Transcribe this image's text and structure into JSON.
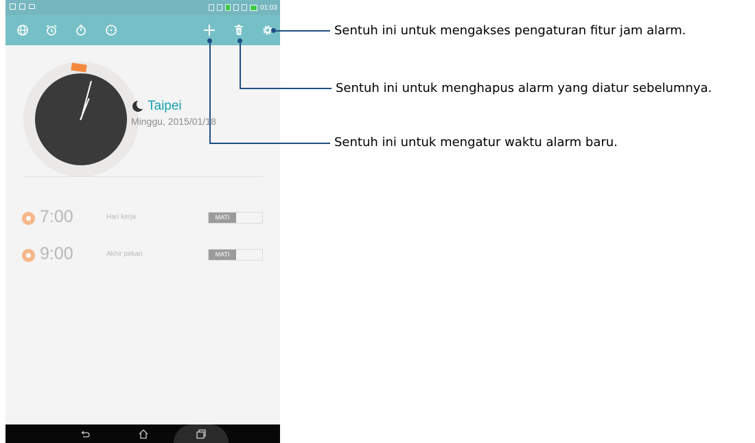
{
  "status_bar": {
    "time": "01:03"
  },
  "toolbar": {
    "tabs": [
      {
        "icon": "globe-icon"
      },
      {
        "icon": "alarm-clock-icon"
      },
      {
        "icon": "stopwatch-icon"
      },
      {
        "icon": "timer-icon"
      }
    ],
    "actions": [
      {
        "icon": "plus-icon"
      },
      {
        "icon": "trash-icon"
      },
      {
        "icon": "gear-icon"
      }
    ]
  },
  "clock": {
    "city": "Taipei",
    "date": "Minggu, 2015/01/18",
    "accent_color": "#14a3b0"
  },
  "alarms": [
    {
      "time": "7:00",
      "label": "Hari kerja",
      "toggle": "MATI"
    },
    {
      "time": "9:00",
      "label": "Akhir pekan",
      "toggle": "MATI"
    }
  ],
  "nav": {
    "buttons": [
      "back-icon",
      "home-icon",
      "recents-icon"
    ]
  },
  "callouts": [
    {
      "text": "Sentuh ini untuk mengakses pengaturan fitur jam alarm."
    },
    {
      "text": "Sentuh ini untuk menghapus alarm yang diatur sebelumnya."
    },
    {
      "text": "Sentuh ini untuk mengatur waktu alarm baru."
    }
  ]
}
